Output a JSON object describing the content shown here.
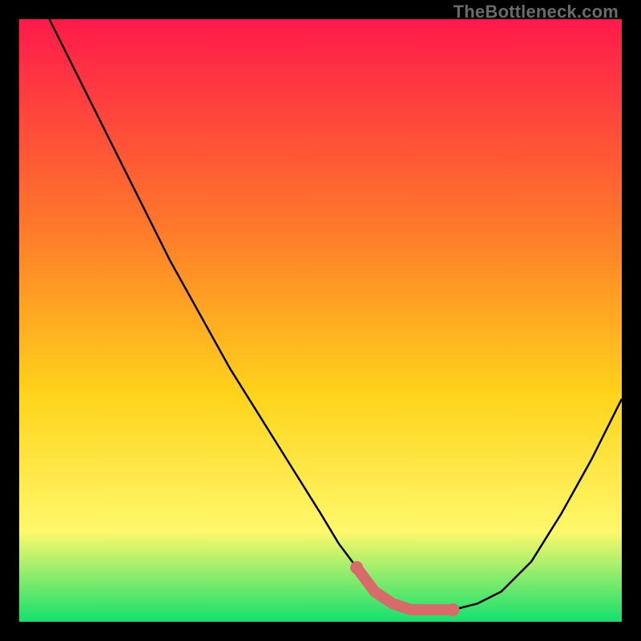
{
  "watermark": "TheBottleneck.com",
  "colors": {
    "gradient_top": "#ff1a4b",
    "gradient_mid1": "#ff7a2a",
    "gradient_mid2": "#ffd31a",
    "gradient_mid3": "#fff86b",
    "gradient_bottom": "#14e06e",
    "curve": "#000000",
    "marker": "#d86a6a",
    "frame_bg": "#000000"
  },
  "chart_data": {
    "type": "line",
    "title": "",
    "xlabel": "",
    "ylabel": "",
    "xlim": [
      0,
      100
    ],
    "ylim": [
      0,
      100
    ],
    "series": [
      {
        "name": "bottleneck-curve",
        "x": [
          5,
          10,
          15,
          20,
          25,
          30,
          35,
          40,
          45,
          50,
          53,
          56,
          59,
          62,
          65,
          68,
          72,
          76,
          80,
          85,
          90,
          95,
          100
        ],
        "y": [
          100,
          90,
          80,
          70,
          60,
          51,
          42,
          34,
          26,
          18,
          13,
          9,
          5,
          3,
          2,
          2,
          2,
          3,
          5,
          10,
          18,
          27,
          37
        ]
      }
    ],
    "highlight": {
      "name": "optimal-region",
      "x": [
        56,
        59,
        62,
        65,
        68,
        72
      ],
      "y": [
        9,
        5,
        3,
        2,
        2,
        2
      ]
    }
  }
}
